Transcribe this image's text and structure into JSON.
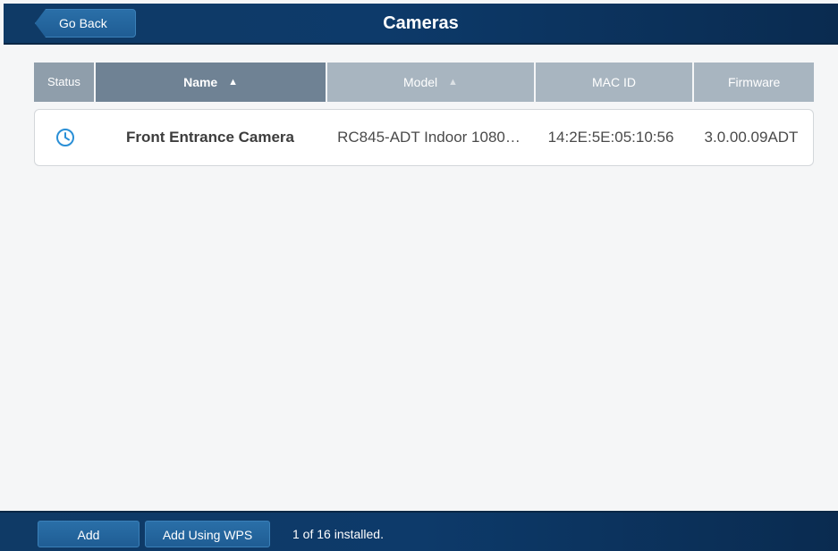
{
  "header": {
    "back_label": "Go Back",
    "title": "Cameras"
  },
  "table": {
    "columns": {
      "status": "Status",
      "name": "Name",
      "model": "Model",
      "mac": "MAC ID",
      "firmware": "Firmware"
    },
    "sorted_column": "Name",
    "rows": [
      {
        "status_icon": "clock-icon",
        "name": "Front Entrance Camera",
        "model": "RC845-ADT Indoor 1080…",
        "mac": "14:2E:5E:05:10:56",
        "firmware": "3.0.00.09ADT"
      }
    ]
  },
  "footer": {
    "add_label": "Add",
    "add_wps_label": "Add Using WPS",
    "install_status": "1 of 16 installed."
  },
  "colors": {
    "header_bg": "#0d3a6a",
    "name_header_bg": "#6f8294",
    "status_icon": "#2a8fd6"
  }
}
